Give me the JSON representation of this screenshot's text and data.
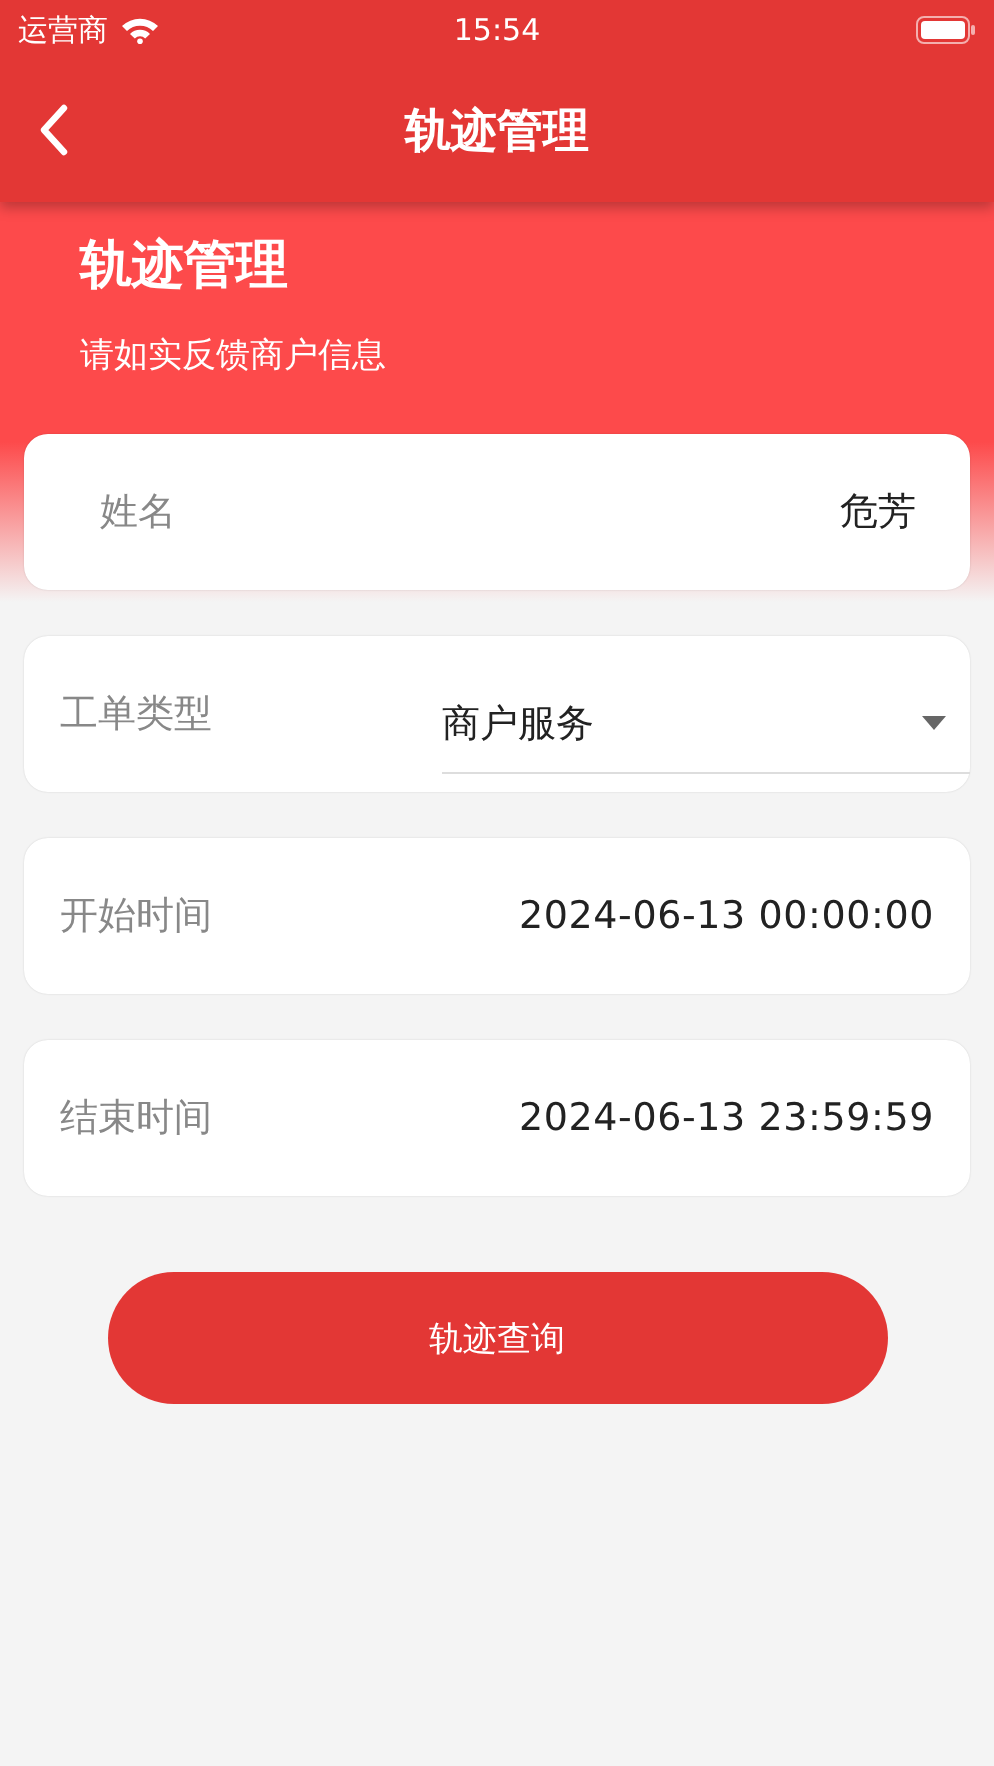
{
  "status_bar": {
    "carrier": "运营商",
    "time": "15:54"
  },
  "nav_bar": {
    "title": "轨迹管理"
  },
  "header": {
    "title": "轨迹管理",
    "subtitle": "请如实反馈商户信息"
  },
  "fields": [
    {
      "kind": "text",
      "label": "姓名",
      "value": "危芳"
    },
    {
      "kind": "select",
      "label": "工单类型",
      "value": "商户服务"
    },
    {
      "kind": "datetime",
      "label": "开始时间",
      "value": "2024-06-13 00:00:00"
    },
    {
      "kind": "datetime",
      "label": "结束时间",
      "value": "2024-06-13 23:59:59"
    }
  ],
  "submit_button": "轨迹查询"
}
